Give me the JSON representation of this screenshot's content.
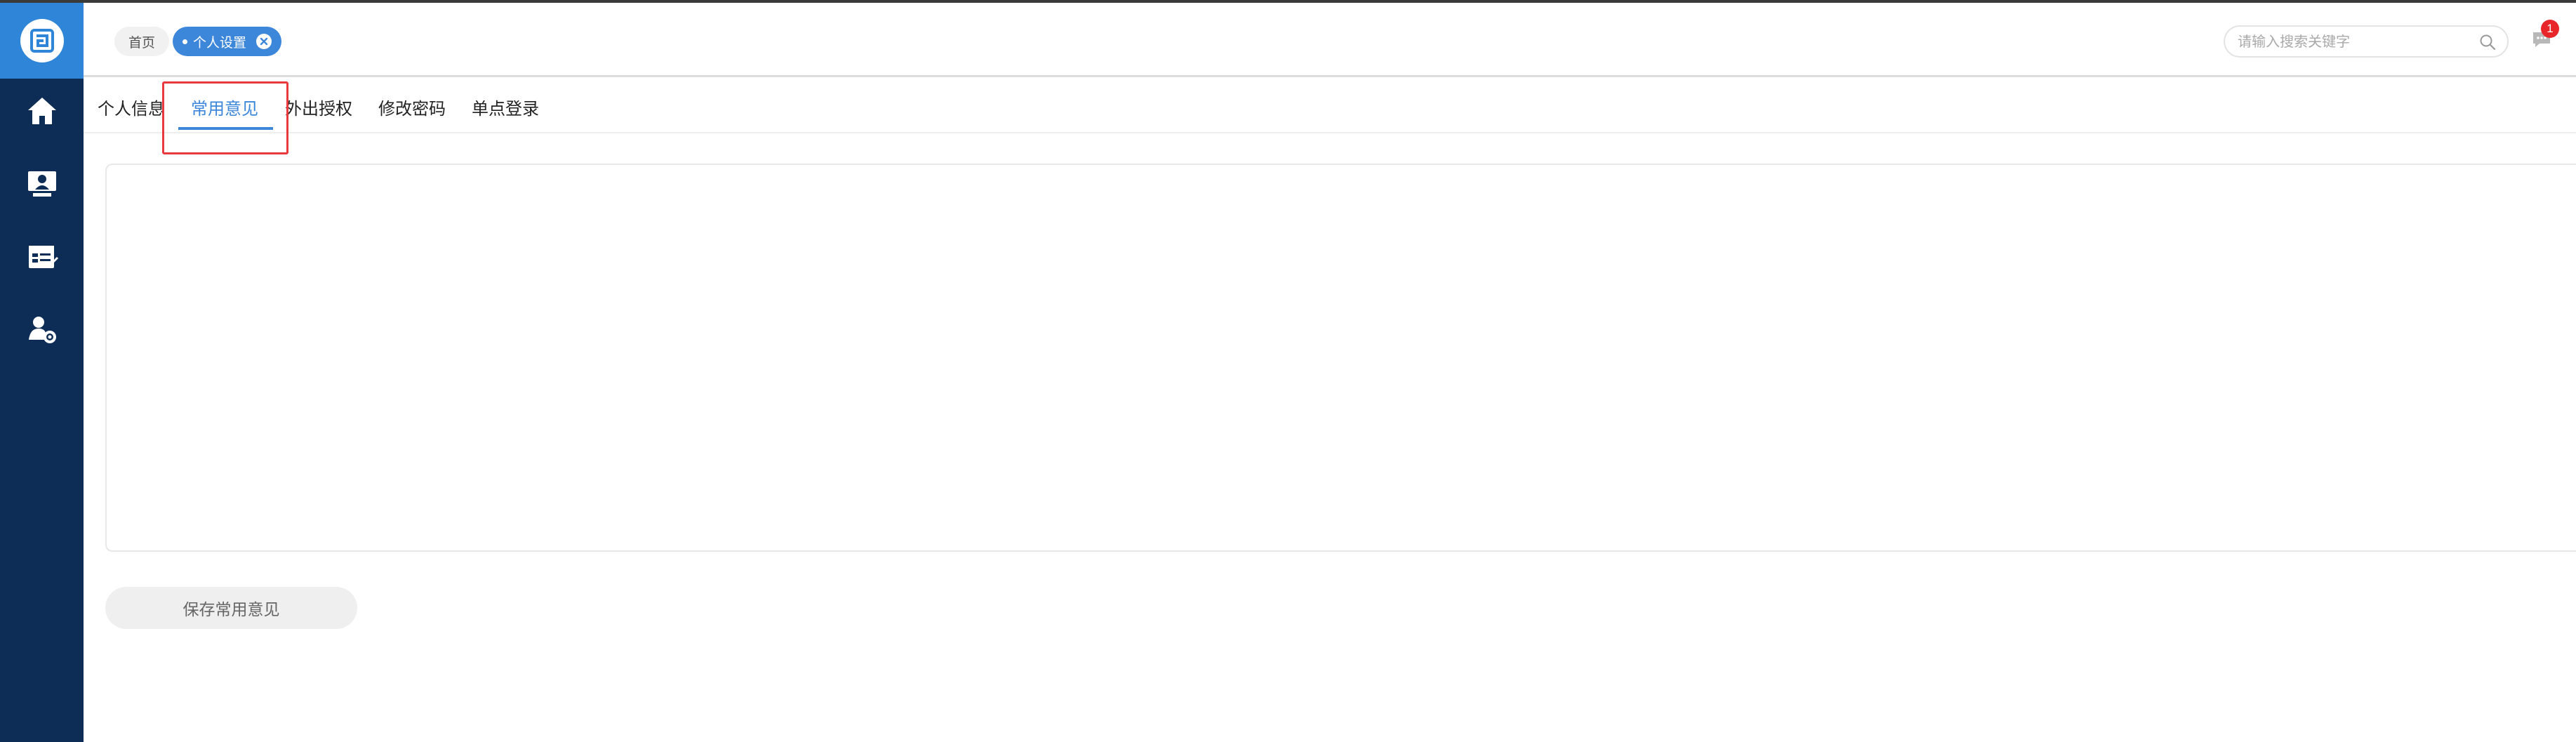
{
  "header": {
    "breadcrumbs": [
      {
        "label": "首页"
      },
      {
        "label": "个人设置"
      }
    ],
    "search": {
      "placeholder": "请输入搜索关键字",
      "value": ""
    },
    "notifications": {
      "count": "1"
    }
  },
  "sidebar": {
    "items": [
      {
        "icon": "home-icon"
      },
      {
        "icon": "monitor-user-icon"
      },
      {
        "icon": "calendar-list-icon"
      },
      {
        "icon": "user-settings-icon"
      }
    ]
  },
  "tabs": [
    {
      "label": "个人信息"
    },
    {
      "label": "常用意见",
      "active": true
    },
    {
      "label": "外出授权"
    },
    {
      "label": "修改密码"
    },
    {
      "label": "单点登录"
    }
  ],
  "content": {
    "opinion_text": "",
    "save_label": "保存常用意见"
  },
  "colors": {
    "sidebar": "#0d2d57",
    "accent": "#3d87da",
    "badge": "#e8262a",
    "highlight": "#e8393f"
  }
}
